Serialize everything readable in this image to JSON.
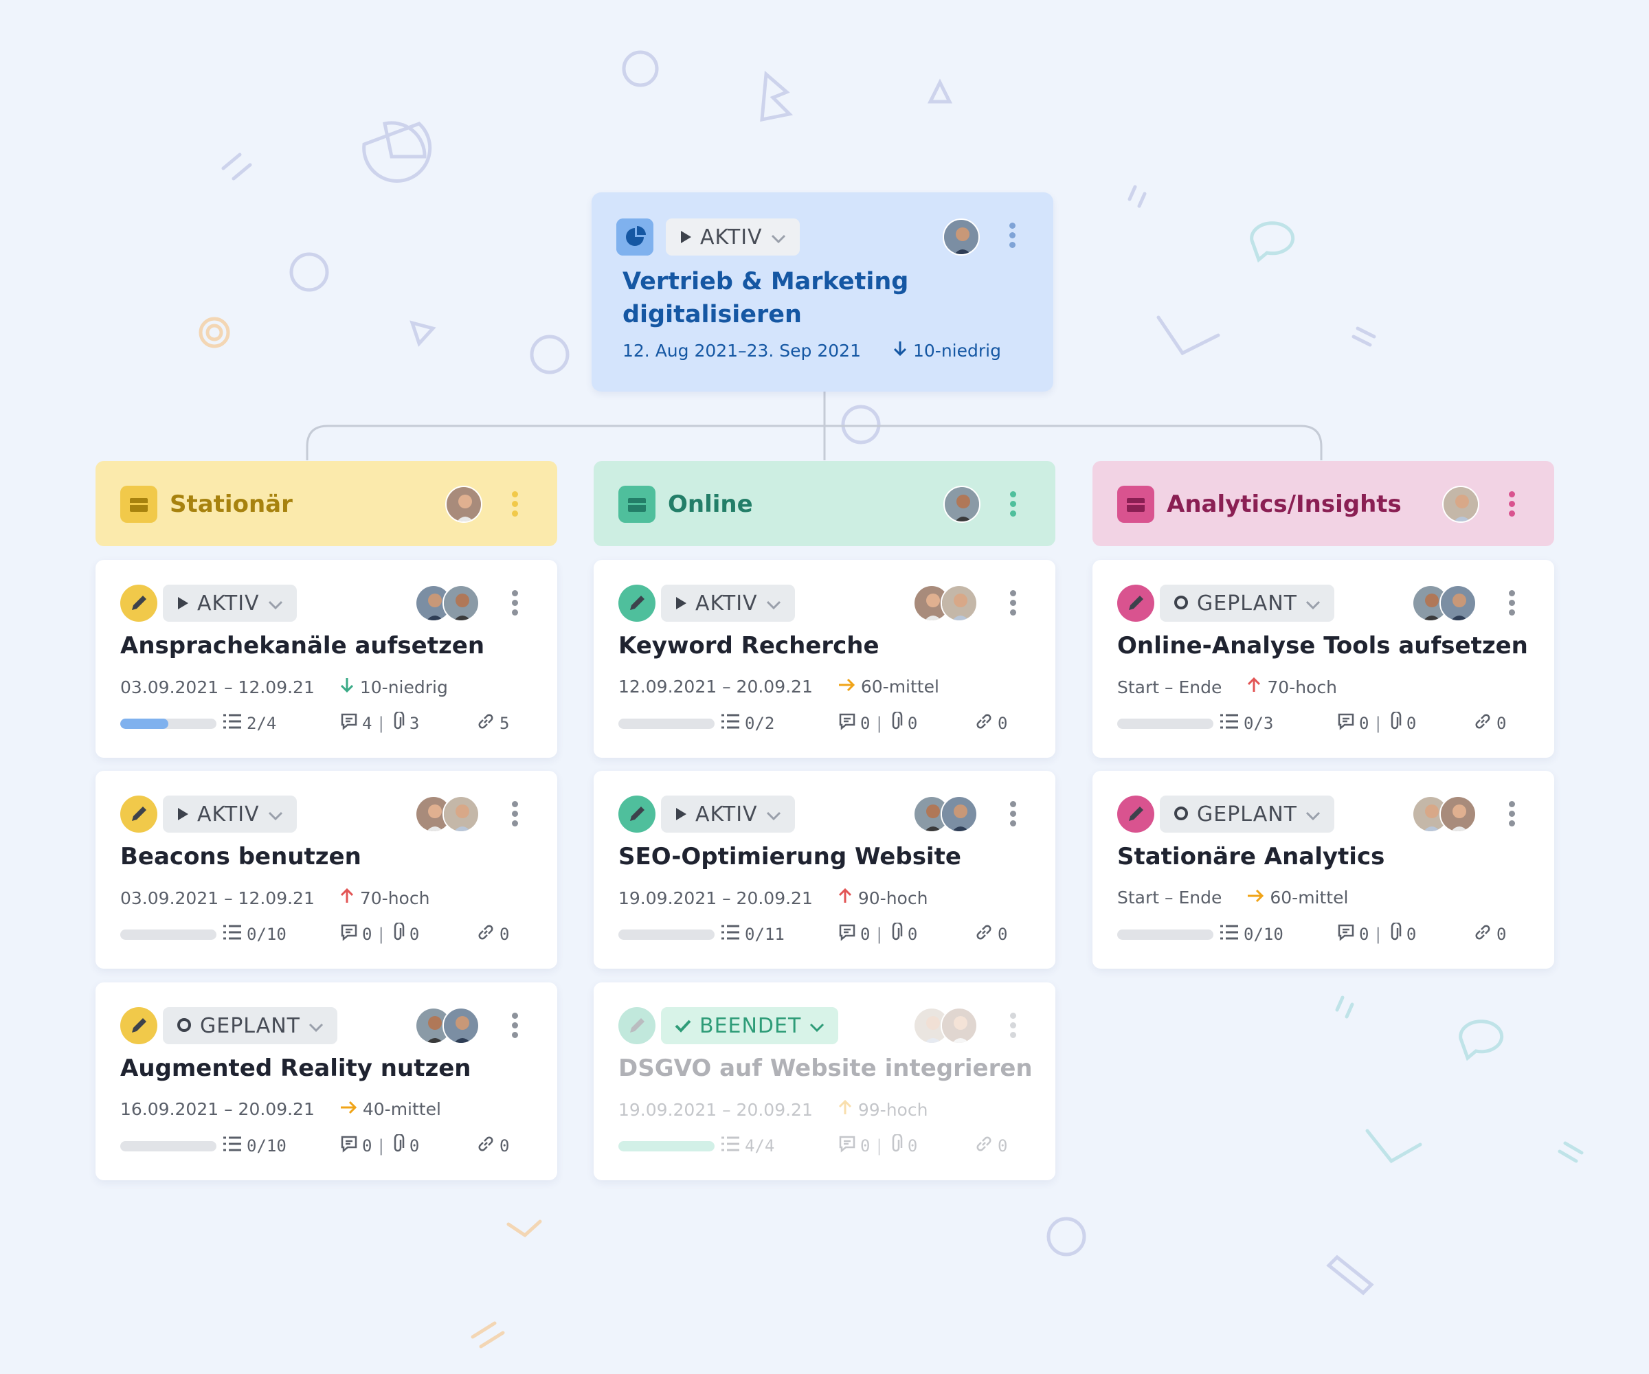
{
  "root": {
    "status": "AKTIV",
    "title": "Vertrieb & Marketing digitalisieren",
    "dates": "12. Aug 2021–23. Sep 2021",
    "priority": "10-niedrig"
  },
  "columns": [
    {
      "title": "Stationär",
      "color": "#fbeaac",
      "accent": "#a7820e",
      "icon_bg": "#f1c94a",
      "cards": [
        {
          "status": "AKTIV",
          "title": "Ansprachekanäle aufsetzen",
          "dates": "03.09.2021 – 12.09.21",
          "priority": "10-niedrig",
          "prio_dir": "down",
          "prio_color": "#3aaa86",
          "progress": 0.5,
          "subtasks": "2/4",
          "comments": "4",
          "attachments": "3",
          "links": "5",
          "bar_color": "#7fb1ee"
        },
        {
          "status": "AKTIV",
          "title": "Beacons benutzen",
          "dates": "03.09.2021 – 12.09.21",
          "priority": "70-hoch",
          "prio_dir": "up",
          "prio_color": "#e25555",
          "progress": 0,
          "subtasks": "0/10",
          "comments": "0",
          "attachments": "0",
          "links": "0",
          "bar_color": "#7fb1ee"
        },
        {
          "status": "GEPLANT",
          "title": "Augmented Reality nutzen",
          "dates": "16.09.2021 – 20.09.21",
          "priority": "40-mittel",
          "prio_dir": "right",
          "prio_color": "#f0a418",
          "progress": 0,
          "subtasks": "0/10",
          "comments": "0",
          "attachments": "0",
          "links": "0",
          "bar_color": "#7fb1ee"
        }
      ]
    },
    {
      "title": "Online",
      "color": "#cdeee2",
      "accent": "#237e68",
      "icon_bg": "#4fbf9c",
      "cards": [
        {
          "status": "AKTIV",
          "title": "Keyword Recherche",
          "dates": "12.09.2021 – 20.09.21",
          "priority": "60-mittel",
          "prio_dir": "right",
          "prio_color": "#f0a418",
          "progress": 0,
          "subtasks": "0/2",
          "comments": "0",
          "attachments": "0",
          "links": "0",
          "bar_color": "#4fbf9c"
        },
        {
          "status": "AKTIV",
          "title": "SEO-Optimierung Website",
          "dates": "19.09.2021 – 20.09.21",
          "priority": "90-hoch",
          "prio_dir": "up",
          "prio_color": "#e25555",
          "progress": 0,
          "subtasks": "0/11",
          "comments": "0",
          "attachments": "0",
          "links": "0",
          "bar_color": "#4fbf9c"
        },
        {
          "status": "BEENDET",
          "title": "DSGVO auf Website integrieren",
          "dates": "19.09.2021 – 20.09.21",
          "priority": "99-hoch",
          "prio_dir": "up",
          "prio_color": "#f0a418",
          "progress": 1,
          "subtasks": "4/4",
          "comments": "0",
          "attachments": "0",
          "links": "0",
          "bar_color": "#7fd7bb"
        }
      ]
    },
    {
      "title": "Analytics/Insights",
      "color": "#f2d3e4",
      "accent": "#8a1f53",
      "icon_bg": "#d9538f",
      "cards": [
        {
          "status": "GEPLANT",
          "title": "Online-Analyse Tools aufsetzen",
          "dates": "Start – Ende",
          "priority": "70-hoch",
          "prio_dir": "up",
          "prio_color": "#e25555",
          "progress": 0,
          "subtasks": "0/3",
          "comments": "0",
          "attachments": "0",
          "links": "0",
          "bar_color": "#d9538f"
        },
        {
          "status": "GEPLANT",
          "title": "Stationäre Analytics",
          "dates": "Start – Ende",
          "priority": "60-mittel",
          "prio_dir": "right",
          "prio_color": "#f0a418",
          "progress": 0,
          "subtasks": "0/10",
          "comments": "0",
          "attachments": "0",
          "links": "0",
          "bar_color": "#d9538f"
        }
      ]
    }
  ]
}
